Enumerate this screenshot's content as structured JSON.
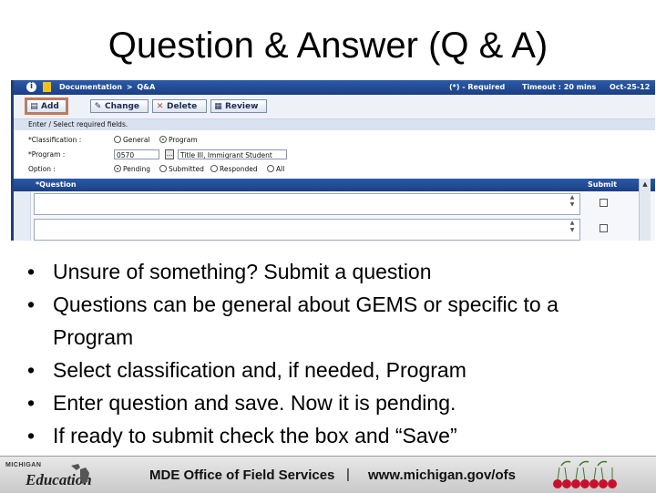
{
  "slide": {
    "title": "Question & Answer (Q & A)"
  },
  "screen": {
    "topbar": {
      "breadcrumb": [
        "Documentation",
        ">",
        "Q&A"
      ],
      "required_note": "(*) - Required",
      "timeout": "Timeout : 20 mins",
      "date": "Oct-25-12"
    },
    "toolbar": {
      "add": "Add",
      "change": "Change",
      "delete": "Delete",
      "review": "Review"
    },
    "form": {
      "header": "Enter / Select required fields.",
      "classification_label": "*Classification :",
      "classification_options": [
        "General",
        "Program"
      ],
      "classification_selected": "Program",
      "program_label": "*Program :",
      "program_code": "0570",
      "program_lookup": "...",
      "program_name": "Title III, Immigrant Student",
      "option_label": "Option :",
      "option_values": [
        "Pending",
        "Submitted",
        "Responded",
        "All"
      ],
      "option_selected": "Pending"
    },
    "grid": {
      "columns": [
        "*Question",
        "Submit"
      ]
    }
  },
  "bullets": [
    "Unsure of something?  Submit a question",
    "Questions can be general about GEMS or specific to a Program",
    "Select classification and, if needed, Program",
    "Enter question and save.  Now it is pending.",
    "If ready to submit check the box and “Save”"
  ],
  "footer": {
    "logo_line1": "MICHIGAN",
    "logo_line2": "Education",
    "office": "MDE Office of Field Services",
    "separator": "|",
    "url": "www.michigan.gov/ofs"
  },
  "colors": {
    "header_blue": "#1c3f84",
    "add_highlight": "#e0733a",
    "cherry_red": "#c8102e"
  }
}
